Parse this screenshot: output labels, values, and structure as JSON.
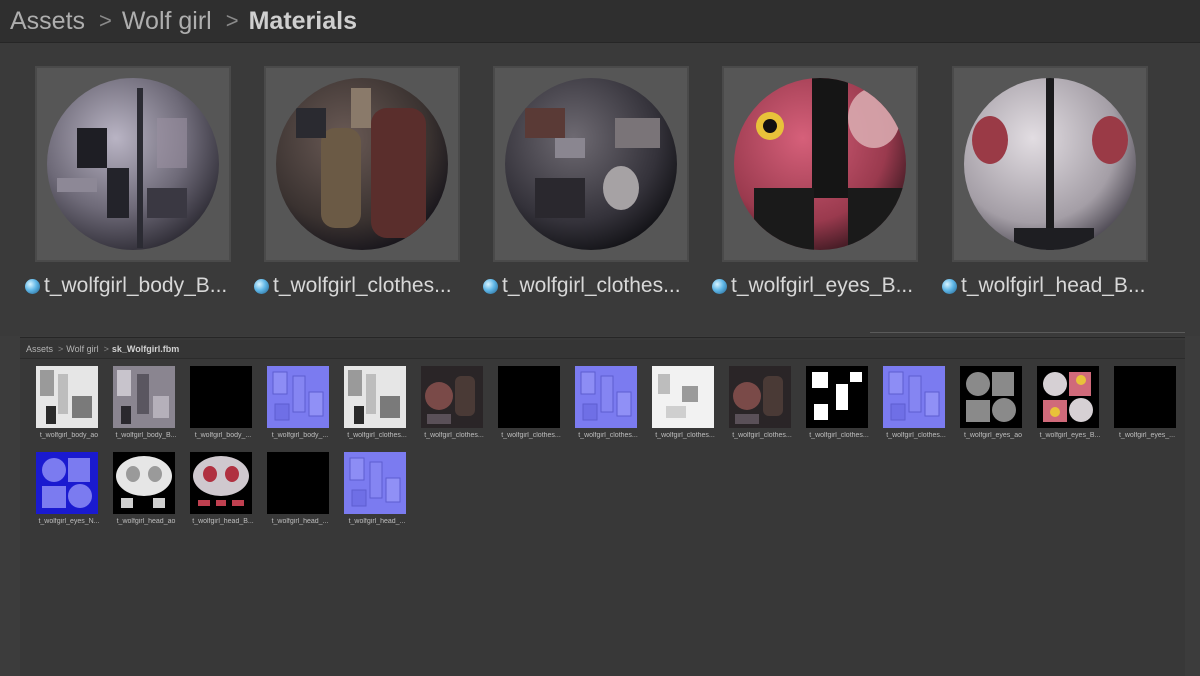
{
  "top_browser": {
    "breadcrumb": [
      "Assets",
      "Wolf girl",
      "Materials"
    ],
    "separator": ">",
    "materials": [
      {
        "label": "t_wolfgirl_body_B...",
        "icon": "material-sphere-icon"
      },
      {
        "label": "t_wolfgirl_clothes...",
        "icon": "material-sphere-icon"
      },
      {
        "label": "t_wolfgirl_clothes...",
        "icon": "material-sphere-icon"
      },
      {
        "label": "t_wolfgirl_eyes_B...",
        "icon": "material-sphere-icon"
      },
      {
        "label": "t_wolfgirl_head_B...",
        "icon": "material-sphere-icon"
      }
    ]
  },
  "bottom_browser": {
    "breadcrumb": [
      "Assets",
      "Wolf girl",
      "sk_Wolfgirl.fbm"
    ],
    "separator": ">",
    "textures": [
      {
        "label": "t_wolfgirl_body_ao",
        "kind": "ao"
      },
      {
        "label": "t_wolfgirl_body_B...",
        "kind": "basecolor"
      },
      {
        "label": "t_wolfgirl_body_...",
        "kind": "black"
      },
      {
        "label": "t_wolfgirl_body_...",
        "kind": "normal"
      },
      {
        "label": "t_wolfgirl_clothes...",
        "kind": "ao"
      },
      {
        "label": "t_wolfgirl_clothes...",
        "kind": "basecolor-dark"
      },
      {
        "label": "t_wolfgirl_clothes...",
        "kind": "black"
      },
      {
        "label": "t_wolfgirl_clothes...",
        "kind": "normal"
      },
      {
        "label": "t_wolfgirl_clothes...",
        "kind": "white"
      },
      {
        "label": "t_wolfgirl_clothes...",
        "kind": "basecolor-dark"
      },
      {
        "label": "t_wolfgirl_clothes...",
        "kind": "mask"
      },
      {
        "label": "t_wolfgirl_clothes...",
        "kind": "normal"
      },
      {
        "label": "t_wolfgirl_eyes_ao",
        "kind": "eyes-ao"
      },
      {
        "label": "t_wolfgirl_eyes_B...",
        "kind": "eyes-base"
      },
      {
        "label": "t_wolfgirl_eyes_...",
        "kind": "black"
      },
      {
        "label": "t_wolfgirl_eyes_N...",
        "kind": "eyes-normal"
      },
      {
        "label": "t_wolfgirl_head_ao",
        "kind": "head-ao"
      },
      {
        "label": "t_wolfgirl_head_B...",
        "kind": "head-base"
      },
      {
        "label": "t_wolfgirl_head_...",
        "kind": "black"
      },
      {
        "label": "t_wolfgirl_head_...",
        "kind": "normal"
      }
    ]
  },
  "colors": {
    "panel_bg": "#3c3c3c",
    "normal_map": "#7b7bf0",
    "material_icon": "#5fb6e6"
  }
}
